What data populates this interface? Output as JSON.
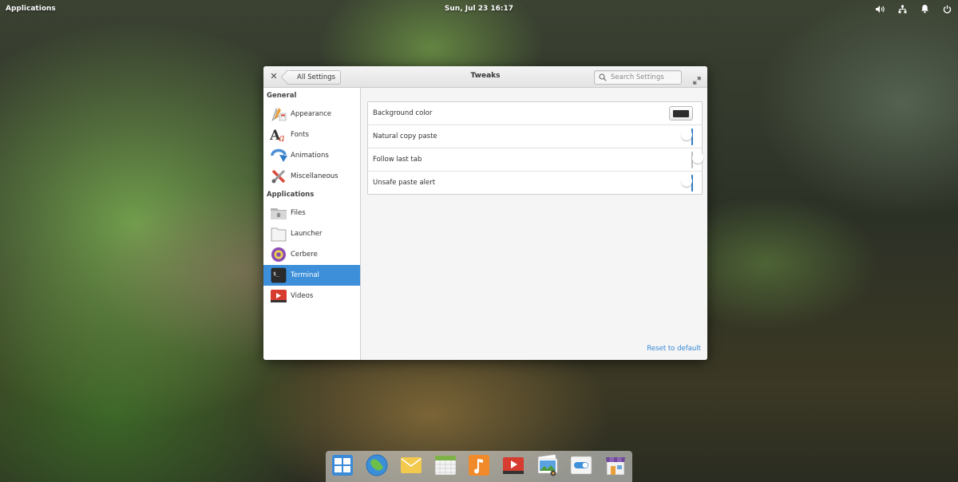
{
  "panel": {
    "applications_label": "Applications",
    "clock": "Sun, Jul 23  16:17"
  },
  "window": {
    "back_label": "All Settings",
    "title": "Tweaks",
    "search_placeholder": "Search Settings"
  },
  "sidebar": {
    "general_header": "General",
    "applications_header": "Applications",
    "items": [
      {
        "label": "Appearance"
      },
      {
        "label": "Fonts"
      },
      {
        "label": "Animations"
      },
      {
        "label": "Miscellaneous"
      },
      {
        "label": "Files"
      },
      {
        "label": "Launcher"
      },
      {
        "label": "Cerbere"
      },
      {
        "label": "Terminal"
      },
      {
        "label": "Videos"
      }
    ],
    "active": "Terminal"
  },
  "settings": {
    "rows": [
      {
        "label": "Background color",
        "control": "color",
        "color": "#2d2d2d"
      },
      {
        "label": "Natural copy paste",
        "control": "switch",
        "on": true
      },
      {
        "label": "Follow last tab",
        "control": "switch",
        "on": false
      },
      {
        "label": "Unsafe paste alert",
        "control": "switch",
        "on": true
      }
    ],
    "reset_label": "Reset to default"
  },
  "dock": {
    "items": [
      "multitasking-view-icon",
      "web-browser-icon",
      "mail-icon",
      "calendar-icon",
      "music-icon",
      "videos-icon",
      "photos-icon",
      "switchboard-icon",
      "appcenter-icon"
    ]
  },
  "colors": {
    "accent": "#3d8fd9",
    "link": "#3689d6"
  }
}
